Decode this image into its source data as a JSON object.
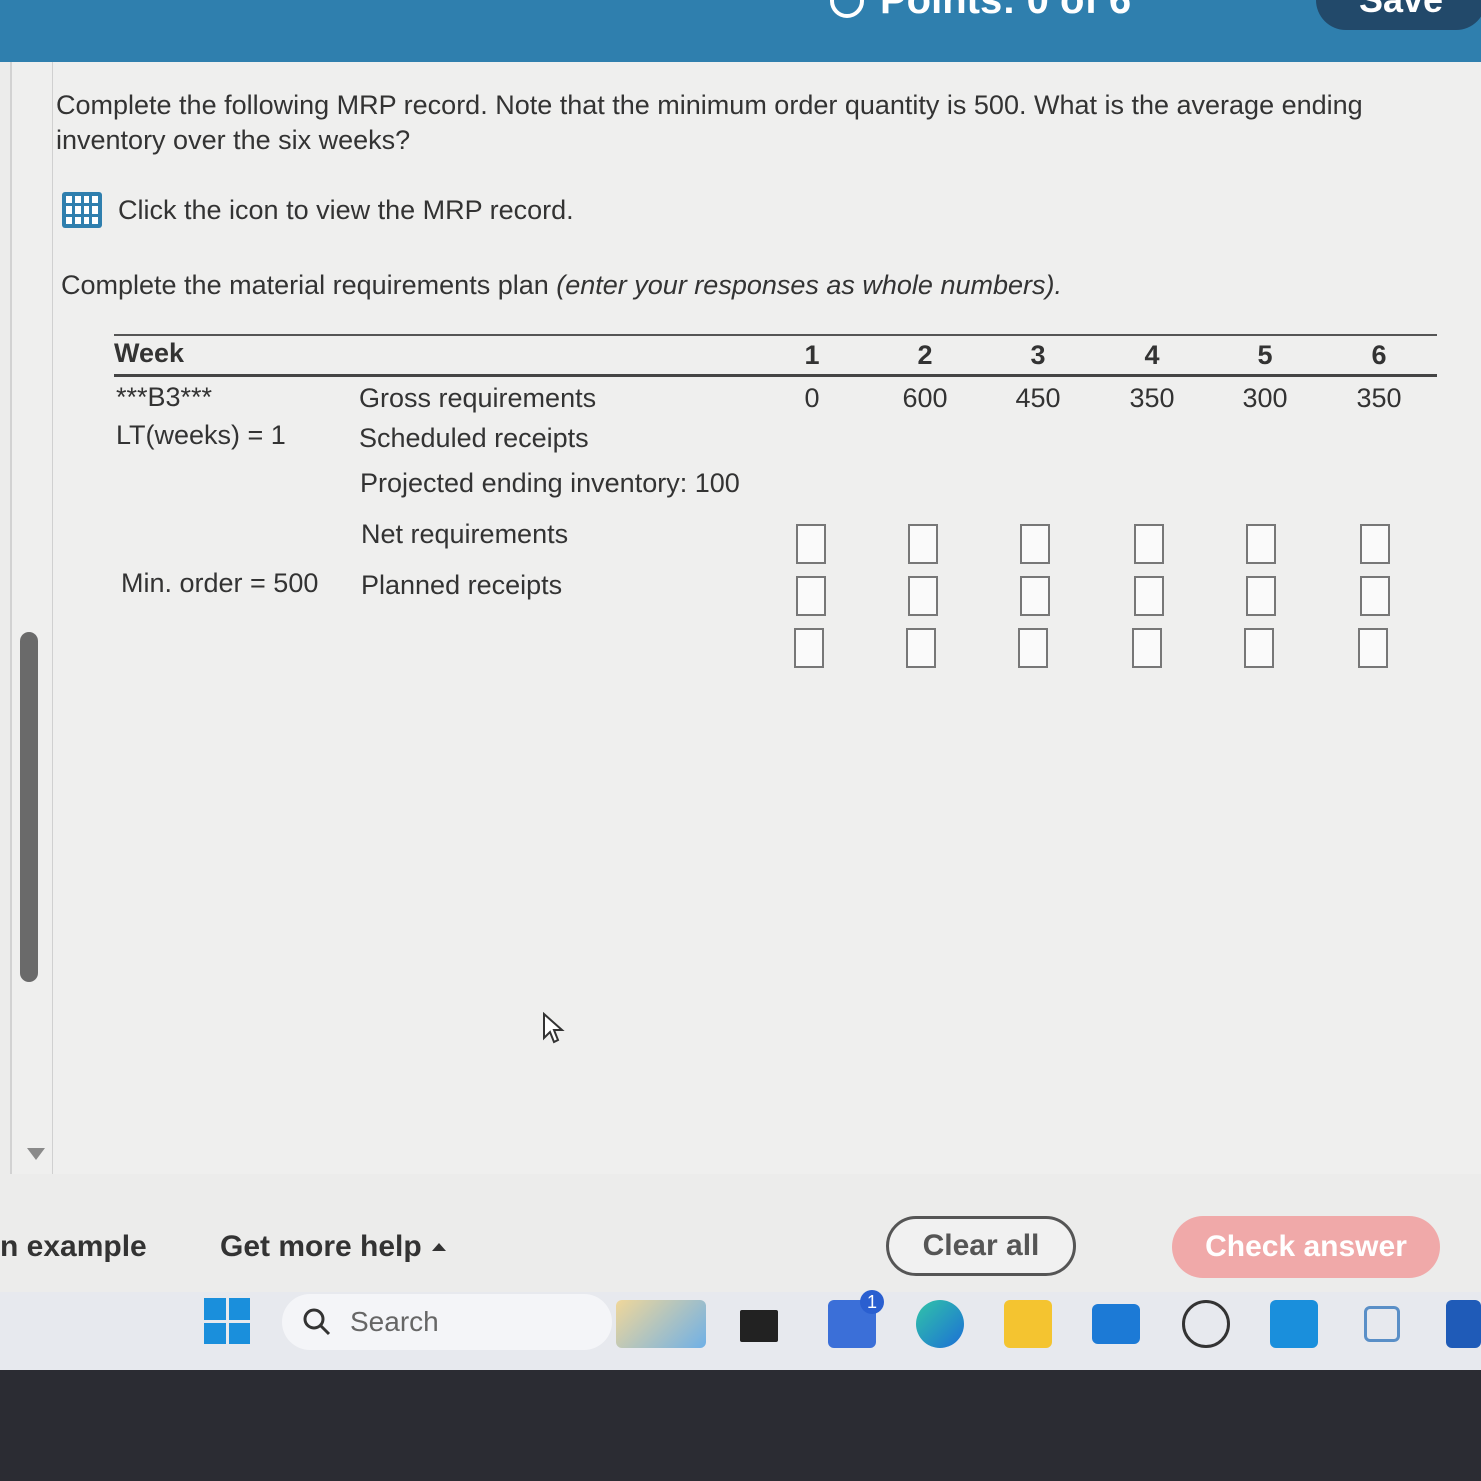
{
  "header": {
    "points_label": "Points: 0 of 6",
    "save_label": "Save"
  },
  "question": {
    "text": "Complete the following MRP record. Note that the minimum order quantity is 500. What is the average ending inventory over the six weeks?",
    "icon_link_label": "Click the icon to view the MRP record.",
    "instruction_prefix": "Complete the material requirements plan ",
    "instruction_italic": "(enter your responses as whole numbers)."
  },
  "mrp": {
    "week_header": "Week",
    "weeks": [
      "1",
      "2",
      "3",
      "4",
      "5",
      "6"
    ],
    "item_name": "***B3***",
    "lead_time": "LT(weeks) = 1",
    "min_order": "Min. order = 500",
    "row_labels": {
      "gross": "Gross requirements",
      "scheduled": "Scheduled receipts",
      "projected": "Projected ending inventory: 100",
      "net": "Net requirements",
      "planned": "Planned receipts"
    },
    "gross_requirements": [
      "0",
      "600",
      "450",
      "350",
      "300",
      "350"
    ]
  },
  "footer": {
    "example_label": "n example",
    "help_label": "Get more help",
    "clear_label": "Clear all",
    "check_label": "Check answer"
  },
  "taskbar": {
    "search_placeholder": "Search",
    "notification_count": "1"
  },
  "colors": {
    "header_bg": "#2f7fae",
    "check_button": "#f0a9a9",
    "taskbar": "#e7e9ee"
  }
}
